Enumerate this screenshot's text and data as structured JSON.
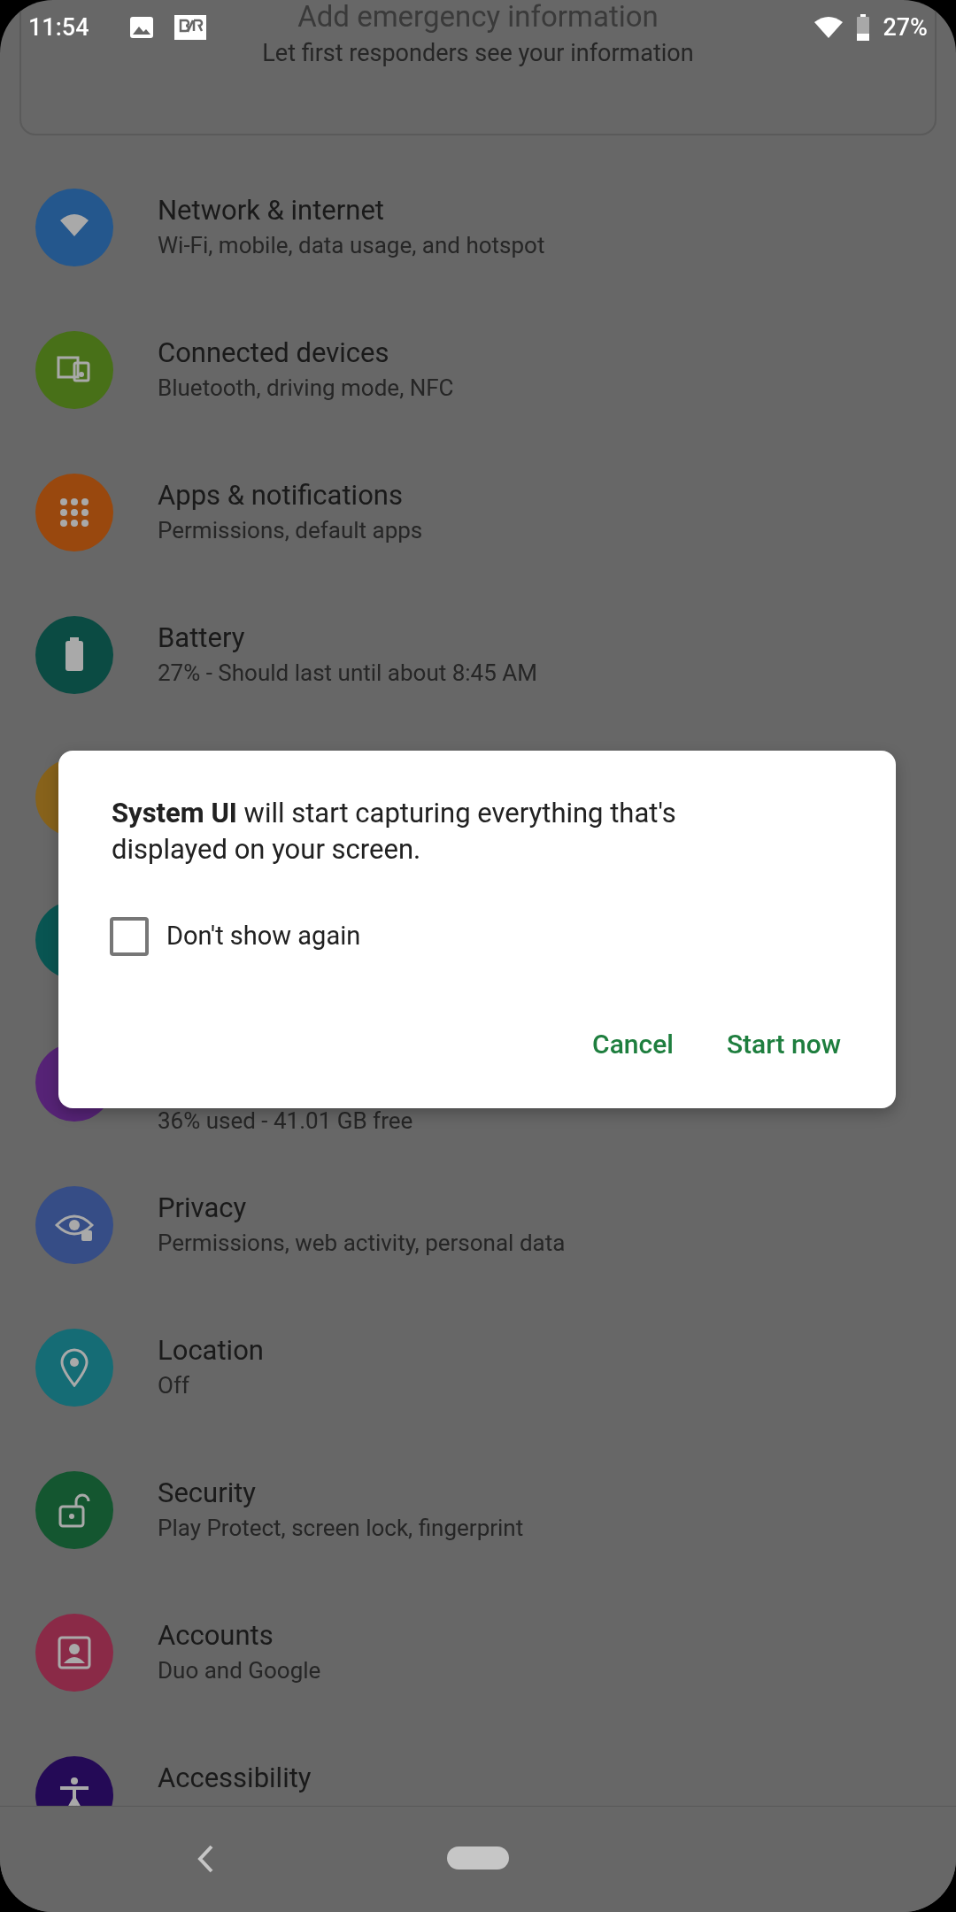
{
  "status_bar": {
    "time": "11:54",
    "battery": "27%"
  },
  "emergency_card": {
    "title": "Add emergency information",
    "subtitle": "Let first responders see your information"
  },
  "settings": [
    {
      "kind": "wifi",
      "title": "Network & internet",
      "subtitle": "Wi-Fi, mobile, data usage, and hotspot",
      "color": "#24578d"
    },
    {
      "kind": "devices",
      "title": "Connected devices",
      "subtitle": "Bluetooth, driving mode, NFC",
      "color": "#487018"
    },
    {
      "kind": "apps",
      "title": "Apps & notifications",
      "subtitle": "Permissions, default apps",
      "color": "#99480e"
    },
    {
      "kind": "battery",
      "title": "Battery",
      "subtitle": "27% - Should last until about 8:45 AM",
      "color": "#0b4b43"
    },
    {
      "kind": "hidden",
      "color": "#87621b"
    },
    {
      "kind": "hidden",
      "color": "#095552"
    },
    {
      "kind": "hidden",
      "subtitle": "36% used - 41.01 GB free",
      "color": "#562376"
    },
    {
      "kind": "eye",
      "title": "Privacy",
      "subtitle": "Permissions, web activity, personal data",
      "color": "#364d86"
    },
    {
      "kind": "pin",
      "title": "Location",
      "subtitle": "Off",
      "color": "#156c75"
    },
    {
      "kind": "lock",
      "title": "Security",
      "subtitle": "Play Protect, screen lock, fingerprint",
      "color": "#145630"
    },
    {
      "kind": "account",
      "title": "Accounts",
      "subtitle": "Duo and Google",
      "color": "#8a2a47"
    },
    {
      "kind": "accessibility",
      "title": "Accessibility",
      "color": "#240a56"
    }
  ],
  "dialog": {
    "message": "**System UI** will start capturing everything that's displayed on your screen.",
    "checkbox": {
      "label": "Don't show again",
      "checked": false
    },
    "buttons": [
      "Cancel",
      "Start now"
    ]
  }
}
